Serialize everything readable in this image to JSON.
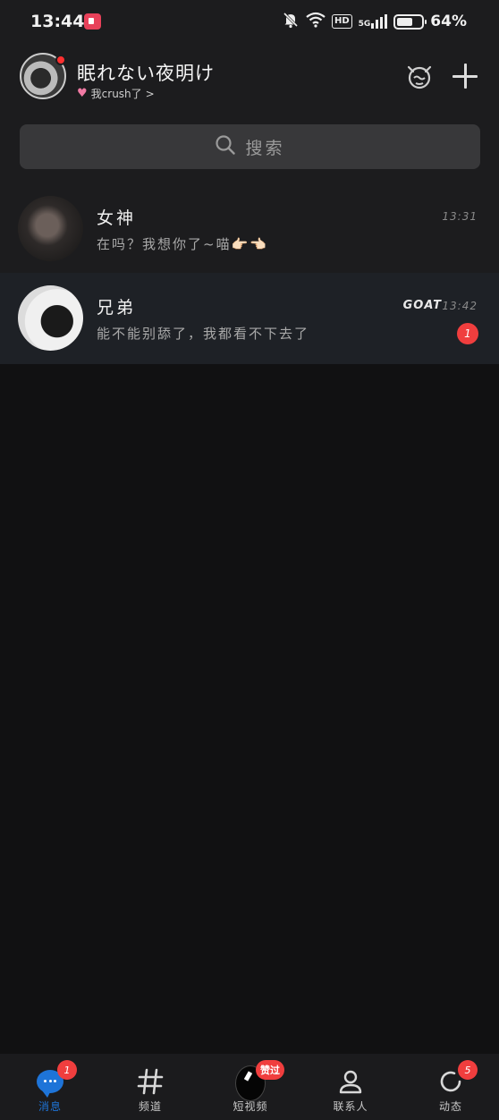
{
  "status_bar": {
    "time": "13:44",
    "network_badge": "HD",
    "network_type": "5G",
    "battery_percent": "64%",
    "battery_level": 0.64,
    "icons": [
      "screen-record-icon",
      "mute-icon",
      "wifi-icon",
      "signal-icon",
      "battery-icon"
    ]
  },
  "header": {
    "username": "眠れない夜明け",
    "status_text": "我crush了",
    "status_chevron": ">",
    "icons": [
      "avatar",
      "heart-icon",
      "cat-face-icon",
      "plus-icon"
    ]
  },
  "search": {
    "placeholder": "搜索",
    "icon": "search-icon"
  },
  "chats": [
    {
      "name": "女神",
      "last_message": "在吗？我想你了~喵👉🏻👈🏻",
      "time": "13:31"
    },
    {
      "name": "兄弟",
      "last_message": "能不能别舔了，我都看不下去了",
      "time": "13:42",
      "badge": "GOAT",
      "unread": "1"
    }
  ],
  "bottom_nav": [
    {
      "label": "消息",
      "icon": "message-icon",
      "badge": "1",
      "active": true
    },
    {
      "label": "频道",
      "icon": "hashtag-icon"
    },
    {
      "label": "短视频",
      "icon": "short-video-icon",
      "badge": "赞过"
    },
    {
      "label": "联系人",
      "icon": "contacts-icon"
    },
    {
      "label": "动态",
      "icon": "refresh-icon",
      "badge": "5"
    }
  ],
  "colors": {
    "background": "#111112",
    "header_bg": "#1c1c1e",
    "accent": "#1e74d8",
    "badge_red": "#f03e3e"
  }
}
